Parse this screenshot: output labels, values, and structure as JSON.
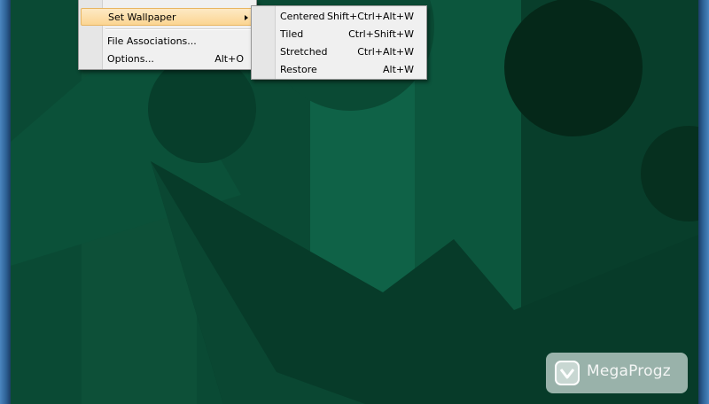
{
  "menu": {
    "items": [
      {
        "label": "Set Wallpaper",
        "highlighted": true,
        "has_submenu": true
      },
      {
        "label": "File Associations...",
        "shortcut": ""
      },
      {
        "label": "Options...",
        "shortcut": "Alt+O"
      }
    ]
  },
  "submenu": {
    "items": [
      {
        "label": "Centered",
        "shortcut": "Shift+Ctrl+Alt+W"
      },
      {
        "label": "Tiled",
        "shortcut": "Ctrl+Shift+W"
      },
      {
        "label": "Stretched",
        "shortcut": "Ctrl+Alt+W"
      },
      {
        "label": "Restore",
        "shortcut": "Alt+W"
      }
    ]
  },
  "watermark": {
    "text": "MegaProgz"
  },
  "colors": {
    "background": "#0a4a34",
    "highlight": "#fbd592",
    "frame": "#2c5f93"
  }
}
